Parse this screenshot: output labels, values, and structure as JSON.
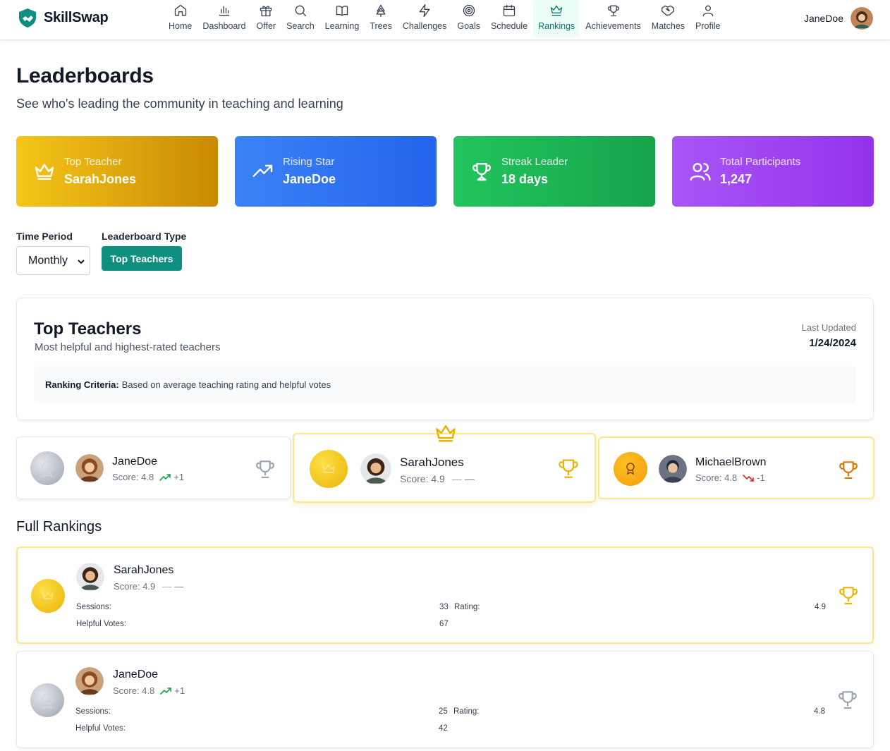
{
  "app": {
    "name": "SkillSwap"
  },
  "nav": {
    "items": [
      {
        "label": "Home",
        "icon": "home-icon"
      },
      {
        "label": "Dashboard",
        "icon": "bar-chart-icon"
      },
      {
        "label": "Offer",
        "icon": "gift-icon"
      },
      {
        "label": "Search",
        "icon": "search-icon"
      },
      {
        "label": "Learning",
        "icon": "book-icon"
      },
      {
        "label": "Trees",
        "icon": "tree-icon"
      },
      {
        "label": "Challenges",
        "icon": "lightning-icon"
      },
      {
        "label": "Goals",
        "icon": "target-icon"
      },
      {
        "label": "Schedule",
        "icon": "calendar-icon"
      },
      {
        "label": "Rankings",
        "icon": "crown-icon",
        "active": true
      },
      {
        "label": "Achievements",
        "icon": "trophy-icon"
      },
      {
        "label": "Matches",
        "icon": "handshake-icon"
      },
      {
        "label": "Profile",
        "icon": "user-icon"
      }
    ],
    "user": "JaneDoe"
  },
  "page": {
    "title": "Leaderboards",
    "subtitle": "See who's leading the community in teaching and learning"
  },
  "stats": [
    {
      "label": "Top Teacher",
      "value": "SarahJones",
      "icon": "crown-icon"
    },
    {
      "label": "Rising Star",
      "value": "JaneDoe",
      "icon": "trending-up-icon"
    },
    {
      "label": "Streak Leader",
      "value": "18 days",
      "icon": "trophy-icon"
    },
    {
      "label": "Total Participants",
      "value": "1,247",
      "icon": "users-icon"
    }
  ],
  "filters": {
    "time_period_label": "Time Period",
    "time_period_value": "Monthly",
    "type_label": "Leaderboard Type",
    "type_value": "Top Teachers"
  },
  "board": {
    "title": "Top Teachers",
    "subtitle": "Most helpful and highest-rated teachers",
    "last_updated_label": "Last Updated",
    "last_updated_value": "1/24/2024",
    "criteria_label": "Ranking Criteria:",
    "criteria_text": "Based on average teaching rating and helpful votes"
  },
  "podium": [
    {
      "rank": 2,
      "name": "JaneDoe",
      "score": "Score: 4.8",
      "change": "+1",
      "trend": "up"
    },
    {
      "rank": 1,
      "name": "SarahJones",
      "score": "Score: 4.9",
      "change": "—",
      "trend": "none"
    },
    {
      "rank": 3,
      "name": "MichaelBrown",
      "score": "Score: 4.8",
      "change": "-1",
      "trend": "down"
    }
  ],
  "full_rankings": {
    "title": "Full Rankings",
    "sessions_label": "Sessions:",
    "rating_label": "Rating:",
    "helpful_label": "Helpful Votes:",
    "rows": [
      {
        "name": "SarahJones",
        "score": "Score: 4.9",
        "change": "—",
        "trend": "none",
        "sessions": "33",
        "rating": "4.9",
        "helpful": "67"
      },
      {
        "name": "JaneDoe",
        "score": "Score: 4.8",
        "change": "+1",
        "trend": "up",
        "sessions": "25",
        "rating": "4.8",
        "helpful": "42"
      }
    ]
  }
}
